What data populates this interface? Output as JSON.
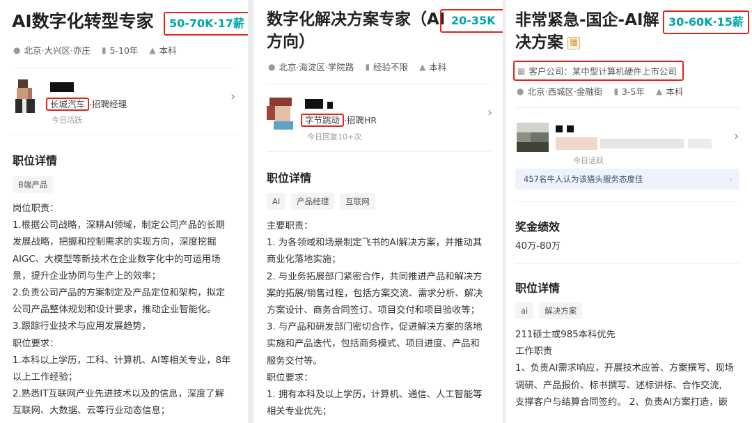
{
  "cards": [
    {
      "title_lines": [
        "AI数字化转型专家"
      ],
      "salary": "50-70K·17薪",
      "meta": [
        "北京·大兴区·亦庄",
        "5-10年",
        "本科"
      ],
      "meta_icons": [
        "location-icon",
        "briefcase-icon",
        "graduation-cap-icon"
      ],
      "company": "长城汽车",
      "role": "·招聘经理",
      "active": "今日活跃",
      "section_title": "职位详情",
      "tags": [
        "B端产品"
      ],
      "lines": [
        "岗位职责：",
        "1.根据公司战略，深耕AI领域，制定公司产品的长期",
        "发展战略，把握和控制需求的实现方向，深度挖掘",
        "AIGC、大模型等新技术在企业数字化中的可运用场",
        "景，提升企业协同与生产上的效率；",
        "2.负责公司产品的方案制定及产品定位和架构，拟定",
        "公司产品整体规划和设计要求，推动企业智能化。",
        "3.跟踪行业技术与应用发展趋势，",
        "职位要求：",
        "1.本科以上学历，工科、计算机、AI等相关专业，8年",
        "以上工作经验；",
        "2.熟悉IT互联网产业先进技术以及的信息，深度了解",
        "互联网、大数据、云等行业动态信息；"
      ]
    },
    {
      "title_lines": [
        "数字化解决方案专家（AI",
        "方向）"
      ],
      "salary": "20-35K",
      "meta": [
        "北京·海淀区·学院路",
        "经验不限",
        "本科"
      ],
      "meta_icons": [
        "location-icon",
        "briefcase-icon",
        "graduation-cap-icon"
      ],
      "company": "字节跳动",
      "role": "·招聘HR",
      "active": "今日回复10+次",
      "section_title": "职位详情",
      "tags": [
        "AI",
        "产品经理",
        "互联网"
      ],
      "lines": [
        "主要职责：",
        "1. 为各领域和场景制定飞书的AI解决方案，并推动其",
        "商业化落地实施；",
        "2. 与业务拓展部门紧密合作，共同推进产品和解决方",
        "案的拓展/销售过程，包括方案交流、需求分析、解决",
        "方案设计、商务合同签订、项目交付和项目验收等；",
        "3. 与产品和研发部门密切合作，促进解决方案的落地",
        "实施和产品迭代，包括商务模式、项目进度、产品和",
        "服务交付等。",
        "职位要求：",
        "1. 拥有本科及以上学历，计算机、通信、人工智能等",
        "相关专业优先；"
      ]
    },
    {
      "title_lines": [
        "非常紧急-国企-AI解",
        "决方案"
      ],
      "title_badge": "猎",
      "salary": "30-60K·15薪",
      "client_label": "客户公司：",
      "client_value": "某中型计算机硬件上市公司",
      "meta": [
        "北京·西城区·金融街",
        "3-5年",
        "本科"
      ],
      "meta_icons": [
        "location-icon",
        "briefcase-icon",
        "graduation-cap-icon"
      ],
      "active": "今日活跃",
      "promo": "457名牛人认为该猎头服务态度佳",
      "bonus_title": "奖金绩效",
      "bonus_value": "40万-80万",
      "section_title": "职位详情",
      "tags": [
        "ai",
        "解决方案"
      ],
      "lines": [
        "211硕士或985本科优先",
        "工作职责",
        "1、负责AI需求响应，开展技术应答、方案撰写、现场",
        "调研、产品报价、标书撰写、述标讲标、合作交流,",
        "支撑客户与结算合同签约。 2、负责AI方案打造，嵌"
      ]
    }
  ]
}
